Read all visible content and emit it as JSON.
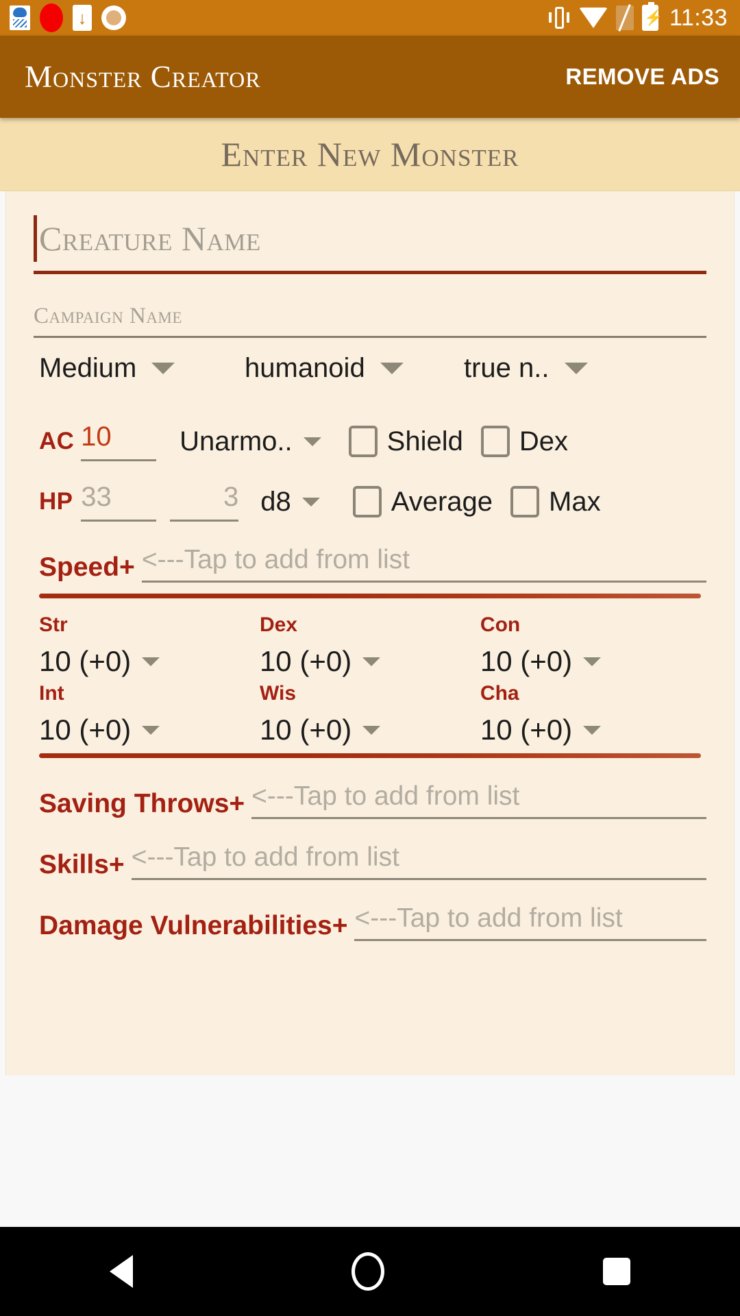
{
  "statusbar": {
    "time": "11:33",
    "left_icons": [
      "weather-icon",
      "record-icon",
      "download-icon",
      "circle-dot-icon"
    ],
    "right_icons": [
      "vibrate-icon",
      "wifi-icon",
      "no-sim-icon",
      "battery-charging-icon"
    ],
    "background_color": "#c8780f"
  },
  "appbar": {
    "title": "Monster Creator",
    "remove_ads_label": "REMOVE ADS",
    "background_color": "#9c5a06"
  },
  "section": {
    "header": "Enter New Monster",
    "background_color": "#f6dfae"
  },
  "form": {
    "creature_name": {
      "value": "",
      "placeholder": "Creature Name"
    },
    "campaign_name": {
      "value": "",
      "placeholder": "Campaign Name"
    },
    "size": {
      "value": "Medium"
    },
    "type": {
      "value": "humanoid"
    },
    "alignment": {
      "value": "true n.."
    },
    "ac": {
      "label": "AC",
      "value": "10",
      "armor": "Unarmo..",
      "shield_label": "Shield",
      "shield_checked": false,
      "dex_label": "Dex",
      "dex_checked": false
    },
    "hp": {
      "label": "HP",
      "total_placeholder": "33",
      "dice_count_placeholder": "3",
      "die": "d8",
      "average_label": "Average",
      "average_checked": false,
      "max_label": "Max",
      "max_checked": false
    },
    "speed": {
      "label": "Speed+",
      "placeholder": "<---Tap to add from list"
    },
    "abilities": {
      "row1": [
        {
          "label": "Str",
          "value": "10 (+0)"
        },
        {
          "label": "Dex",
          "value": "10 (+0)"
        },
        {
          "label": "Con",
          "value": "10 (+0)"
        }
      ],
      "row2": [
        {
          "label": "Int",
          "value": "10 (+0)"
        },
        {
          "label": "Wis",
          "value": "10 (+0)"
        },
        {
          "label": "Cha",
          "value": "10 (+0)"
        }
      ]
    },
    "saving_throws": {
      "label": "Saving Throws+",
      "placeholder": "<---Tap to add from list"
    },
    "skills": {
      "label": "Skills+",
      "placeholder": "<---Tap to add from list"
    },
    "damage_vulnerabilities": {
      "label": "Damage Vulnerabilities+",
      "placeholder": "<---Tap to add from list"
    }
  },
  "colors": {
    "accent_red": "#a32113",
    "divider_red": "#a42c11",
    "card_bg": "#fbf0df",
    "header_bg": "#f6dfae"
  },
  "navbar": {
    "back": "back-icon",
    "home": "home-icon",
    "recents": "recents-icon"
  }
}
